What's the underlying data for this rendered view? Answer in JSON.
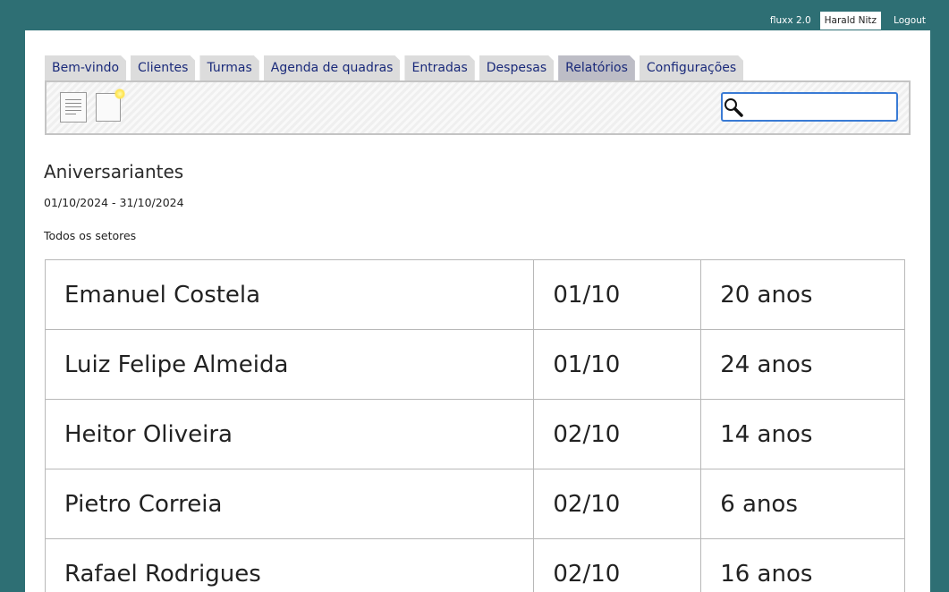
{
  "topbar": {
    "version": "fluxx 2.0",
    "user": "Harald Nitz",
    "logout": "Logout"
  },
  "tabs": [
    {
      "label": "Bem-vindo",
      "active": false
    },
    {
      "label": "Clientes",
      "active": false
    },
    {
      "label": "Turmas",
      "active": false
    },
    {
      "label": "Agenda de quadras",
      "active": false
    },
    {
      "label": "Entradas",
      "active": false
    },
    {
      "label": "Despesas",
      "active": false
    },
    {
      "label": "Relatórios",
      "active": true
    },
    {
      "label": "Configurações",
      "active": false
    }
  ],
  "toolbar": {
    "icons": [
      "report-document-icon",
      "new-document-icon"
    ],
    "search": {
      "value": "",
      "placeholder": "",
      "icon": "magnifier-icon"
    }
  },
  "report": {
    "title": "Aniversariantes",
    "date_range": "01/10/2024 - 31/10/2024",
    "sector": "Todos os setores",
    "rows": [
      {
        "name": "Emanuel Costela",
        "date": "01/10",
        "age": "20 anos"
      },
      {
        "name": "Luiz Felipe Almeida",
        "date": "01/10",
        "age": "24 anos"
      },
      {
        "name": "Heitor Oliveira",
        "date": "02/10",
        "age": "14 anos"
      },
      {
        "name": "Pietro Correia",
        "date": "02/10",
        "age": "6 anos"
      },
      {
        "name": "Rafael Rodrigues",
        "date": "02/10",
        "age": "16 anos"
      }
    ]
  },
  "colors": {
    "background": "#2e6f74",
    "tab_text": "#1a2a7a",
    "search_border": "#3a7bd5"
  }
}
